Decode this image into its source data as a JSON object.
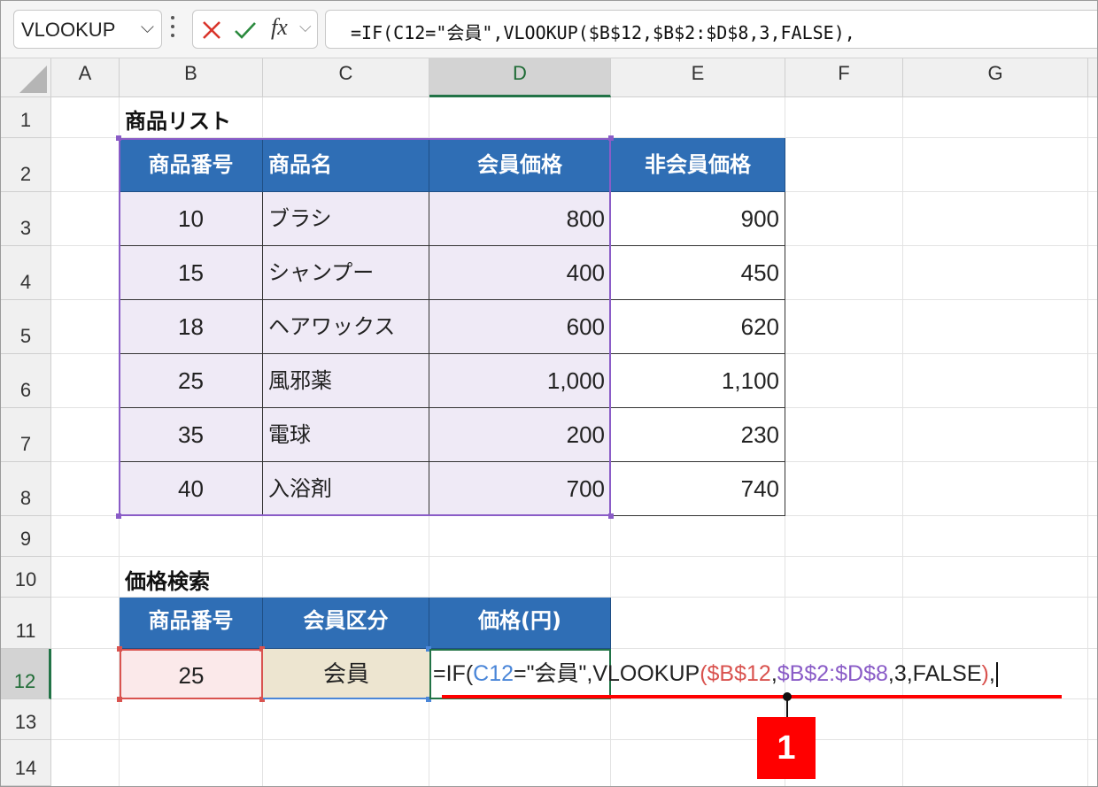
{
  "formula_bar": {
    "name_box": "VLOOKUP",
    "name_box_arrow": "⌵",
    "fx": "fx",
    "fx_arrow": "⌵",
    "formula": "=IF(C12=\"会員\",VLOOKUP($B$12,$B$2:$D$8,3,FALSE),"
  },
  "columns": [
    "A",
    "B",
    "C",
    "D",
    "E",
    "F",
    "G"
  ],
  "rows": [
    "1",
    "2",
    "3",
    "4",
    "5",
    "6",
    "7",
    "8",
    "9",
    "10",
    "11",
    "12",
    "13",
    "14"
  ],
  "product_list": {
    "title": "商品リスト",
    "headers": [
      "商品番号",
      "商品名",
      "会員価格",
      "非会員価格"
    ],
    "rows": [
      {
        "id": "10",
        "name": "ブラシ",
        "member": "800",
        "nonmember": "900"
      },
      {
        "id": "15",
        "name": "シャンプー",
        "member": "400",
        "nonmember": "450"
      },
      {
        "id": "18",
        "name": "ヘアワックス",
        "member": "600",
        "nonmember": "620"
      },
      {
        "id": "25",
        "name": "風邪薬",
        "member": "1,000",
        "nonmember": "1,100"
      },
      {
        "id": "35",
        "name": "電球",
        "member": "200",
        "nonmember": "230"
      },
      {
        "id": "40",
        "name": "入浴剤",
        "member": "700",
        "nonmember": "740"
      }
    ]
  },
  "price_search": {
    "title": "価格検索",
    "headers": [
      "商品番号",
      "会員区分",
      "価格(円)"
    ],
    "id_value": "25",
    "member_type": "会員",
    "edit_formula": {
      "p1": "=IF(",
      "p2": "C12",
      "p3": "=\"会員\",VLOOKUP",
      "p4": "(",
      "p5": "$B$12",
      "p6": ",",
      "p7": "$B$2:$D$8",
      "p8": ",3,FALSE",
      "p9": ")",
      "p10": ","
    }
  },
  "callout": {
    "number": "1"
  },
  "colors": {
    "header_blue": "#2f6eb5",
    "data_fill": "#efeaf6",
    "formula_ref_blue": "#4a86d8",
    "formula_ref_red": "#d9534f",
    "formula_ref_purple": "#8a5cc7",
    "callout_red": "#ff0000",
    "excel_green": "#217346"
  }
}
